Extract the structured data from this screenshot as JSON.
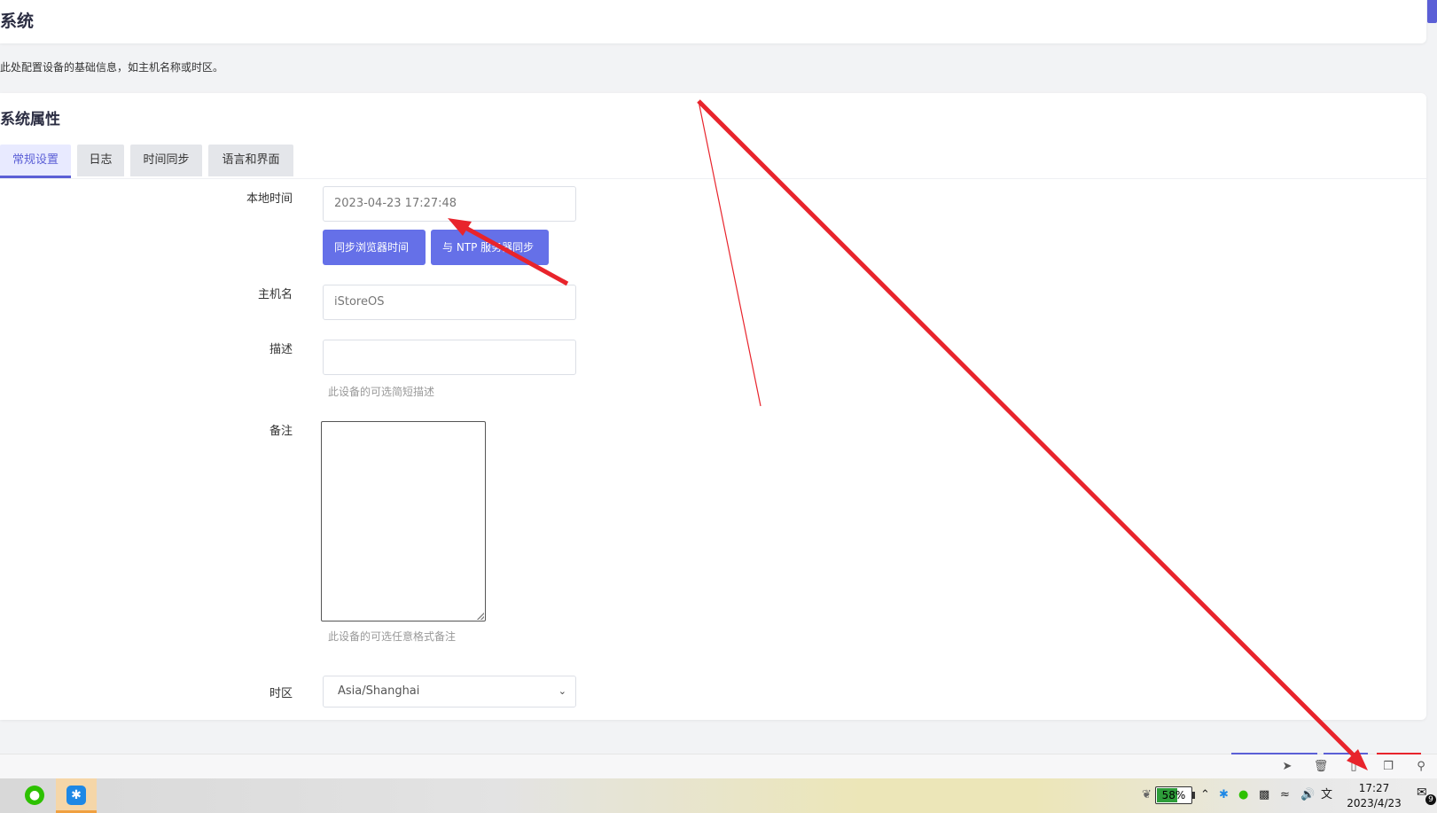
{
  "header": {
    "title": "系统"
  },
  "page_description": "此处配置设备的基础信息，如主机名称或时区。",
  "section": {
    "title": "系统属性",
    "tabs": [
      {
        "label": "常规设置",
        "active": true
      },
      {
        "label": "日志",
        "active": false
      },
      {
        "label": "时间同步",
        "active": false
      },
      {
        "label": "语言和界面",
        "active": false
      }
    ]
  },
  "form": {
    "local_time": {
      "label": "本地时间",
      "value": "2023-04-23 17:27:48"
    },
    "sync_browser_label": "同步浏览器时间",
    "sync_ntp_label": "与 NTP 服务器同步",
    "hostname": {
      "label": "主机名",
      "value": "iStoreOS"
    },
    "description": {
      "label": "描述",
      "value": "",
      "hint": "此设备的可选简短描述"
    },
    "notes": {
      "label": "备注",
      "value": "",
      "hint": "此设备的可选任意格式备注"
    },
    "timezone": {
      "label": "时区",
      "value": "Asia/Shanghai"
    }
  },
  "bottom_toolbar": {
    "icons": [
      "rocket-icon",
      "trash-icon",
      "speaker-icon",
      "window-icon",
      "search-icon"
    ]
  },
  "taskbar": {
    "apps": [
      "wechat-icon",
      "lark-icon"
    ],
    "battery": "58%",
    "clock_time": "17:27",
    "clock_date": "2023/4/23",
    "notification_count": "9"
  },
  "colors": {
    "accent": "#5b5fd6",
    "button": "#6570e8",
    "annotation_arrow": "#e8242c"
  }
}
